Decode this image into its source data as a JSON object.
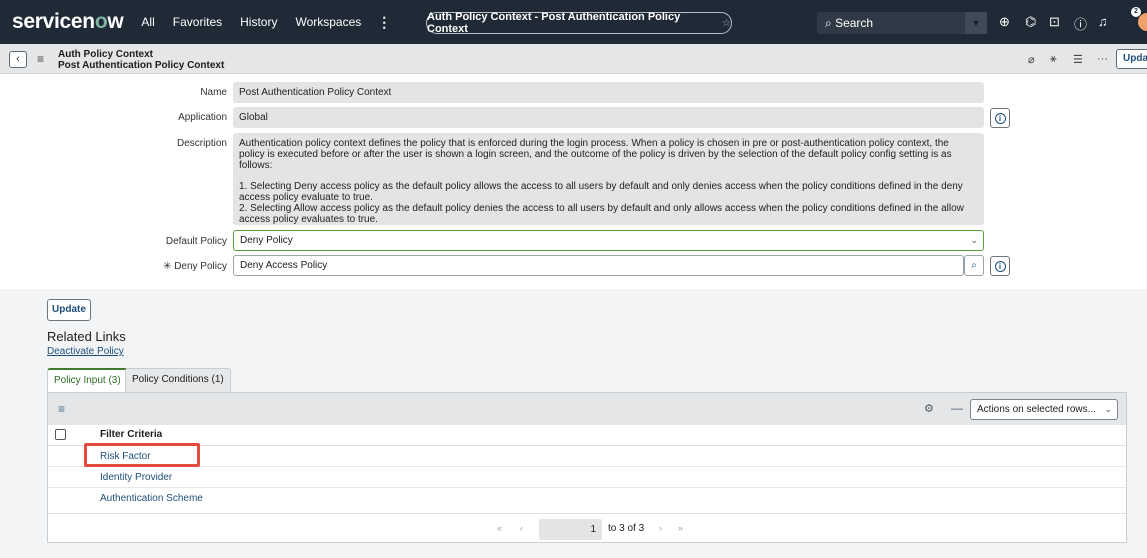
{
  "topnav": {
    "logo_prefix": "servicen",
    "logo_o": "o",
    "logo_suffix": "w",
    "items": [
      "All",
      "Favorites",
      "History",
      "Workspaces"
    ],
    "more_glyph": "⋮",
    "context_title": "Auth Policy Context - Post Authentication Policy Context",
    "search_placeholder": "Search",
    "notification_count": "2"
  },
  "form_header": {
    "table_name": "Auth Policy Context",
    "record_name": "Post Authentication Policy Context",
    "update_label": "Upda"
  },
  "fields": {
    "name": {
      "label": "Name",
      "value": "Post Authentication Policy Context"
    },
    "application": {
      "label": "Application",
      "value": "Global"
    },
    "description": {
      "label": "Description",
      "paragraphs": [
        "Authentication policy context defines the policy that is enforced during the login process. When a policy is chosen in pre or post-authentication policy context, the policy is executed before or after the user is shown a login screen, and the outcome of the policy is driven by the selection of the default policy config setting is as follows:",
        "1. Selecting Deny access policy as the default policy allows the access to all users by default and only denies access when the policy conditions defined in the deny access policy evaluate to true.\n2. Selecting Allow access policy as the default policy denies the access to all users by default and only allows access when the policy conditions defined in the allow access policy evaluates to true."
      ]
    },
    "default_policy": {
      "label": "Default Policy",
      "value": "Deny Policy"
    },
    "deny_policy": {
      "label": "Deny Policy",
      "required_mark": "✳",
      "value": "Deny Access Policy"
    }
  },
  "lower": {
    "update_label": "Update",
    "related_links_title": "Related Links",
    "deactivate_link": "Deactivate Policy"
  },
  "tabs": [
    {
      "label": "Policy Input (3)",
      "active": true
    },
    {
      "label": "Policy Conditions (1)",
      "active": false
    }
  ],
  "list": {
    "actions_placeholder": "Actions on selected rows...",
    "column_header": "Filter Criteria",
    "rows": [
      "Risk Factor",
      "Identity Provider",
      "Authentication Scheme"
    ],
    "pager_value": "1",
    "pager_text": "to 3 of 3"
  },
  "colors": {
    "nav_bg": "#1f2a36",
    "accent_green": "#3d7a2f",
    "link_blue": "#1f4e7a",
    "highlight_red": "#e34b3f"
  }
}
